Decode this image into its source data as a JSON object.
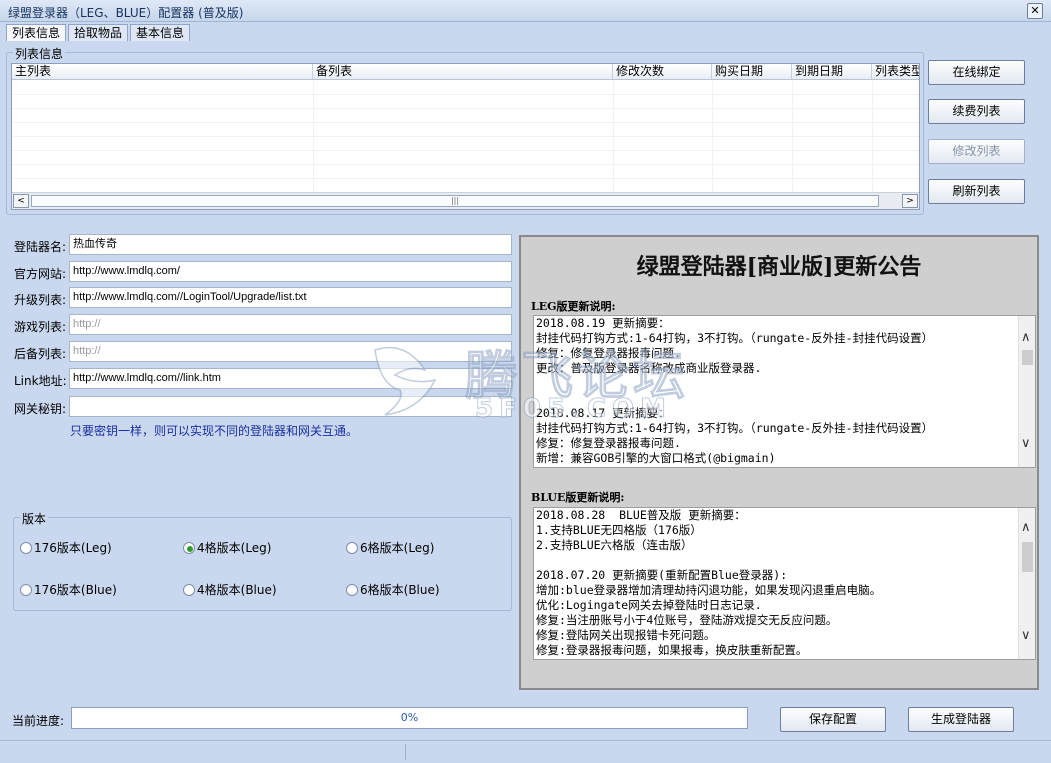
{
  "window": {
    "title": "绿盟登录器（LEG、BLUE）配置器 (普及版)",
    "close_glyph": "✕"
  },
  "tabs": [
    "列表信息",
    "拾取物品",
    "基本信息"
  ],
  "list_group": {
    "label": "列表信息",
    "columns": [
      "主列表",
      "备列表",
      "修改次数",
      "购买日期",
      "到期日期",
      "列表类型"
    ],
    "scroll_left": "<",
    "scroll_right": ">",
    "thumb_grip": "|||"
  },
  "side_buttons": {
    "bind": "在线绑定",
    "renew": "续费列表",
    "modify": "修改列表",
    "refresh": "刷新列表"
  },
  "form": {
    "fields": [
      {
        "label": "登陆器名:",
        "value": "热血传奇",
        "placeholder": ""
      },
      {
        "label": "官方网站:",
        "value": "http://www.lmdlq.com/",
        "placeholder": ""
      },
      {
        "label": "升级列表:",
        "value": "http://www.lmdlq.com//LoginTool/Upgrade/list.txt",
        "placeholder": ""
      },
      {
        "label": "游戏列表:",
        "value": "",
        "placeholder": "http://"
      },
      {
        "label": "后备列表:",
        "value": "",
        "placeholder": "http://"
      },
      {
        "label": "Link地址:",
        "value": "http://www.lmdlq.com//link.htm",
        "placeholder": ""
      },
      {
        "label": "网关秘钥:",
        "value": "",
        "placeholder": ""
      }
    ],
    "hint": "只要密钥一样，则可以实现不同的登陆器和网关互通。"
  },
  "version_group": {
    "label": "版本",
    "options": [
      {
        "label": "176版本(Leg)",
        "checked": false
      },
      {
        "label": "4格版本(Leg)",
        "checked": true
      },
      {
        "label": "6格版本(Leg)",
        "checked": false
      },
      {
        "label": "176版本(Blue)",
        "checked": false
      },
      {
        "label": "4格版本(Blue)",
        "checked": false
      },
      {
        "label": "6格版本(Blue)",
        "checked": false
      }
    ]
  },
  "notice": {
    "title": "绿盟登陆器[商业版]更新公告",
    "leg_label": "LEG版更新说明:",
    "leg_lines": [
      "2018.08.19 更新摘要：",
      "封挂代码打钩方式:1-64打钩，3不打钩。（rungate-反外挂-封挂代码设置）",
      "修复：修复登录器报毒问题.",
      "更改：普及版登录器名称改成商业版登录器.",
      "",
      "",
      "2018.08.17 更新摘要：",
      "封挂代码打钩方式:1-64打钩，3不打钩。（rungate-反外挂-封挂代码设置）",
      "修复：修复登录器报毒问题.",
      "新增：兼容GOB引擎的大窗口格式(@bigmain)"
    ],
    "blue_label": "BLUE版更新说明:",
    "blue_lines": [
      "2018.08.28  BLUE普及版 更新摘要：",
      "1.支持BLUE无四格版（176版）",
      "2.支持BLUE六格版（连击版）",
      "",
      "2018.07.20 更新摘要(重新配置Blue登录器):",
      "增加:blue登录器增加清理劫持闪退功能，如果发现闪退重启电脑。",
      "优化:Logingate网关去掉登陆时日志记录.",
      "修复:当注册账号小于4位账号，登陆游戏提交无反应问题。",
      "修复:登陆网关出现报错卡死问题。",
      "修复:登录器报毒问题，如果报毒，换皮肤重新配置。"
    ],
    "scroll_up": "∧",
    "scroll_down": "∨"
  },
  "bottom": {
    "progress_label": "当前进度:",
    "progress_text": "0%",
    "progress_value": 0,
    "save": "保存配置",
    "generate": "生成登陆器"
  },
  "watermark": {
    "text": "腾飞论坛",
    "sub": "5F05.COM"
  }
}
